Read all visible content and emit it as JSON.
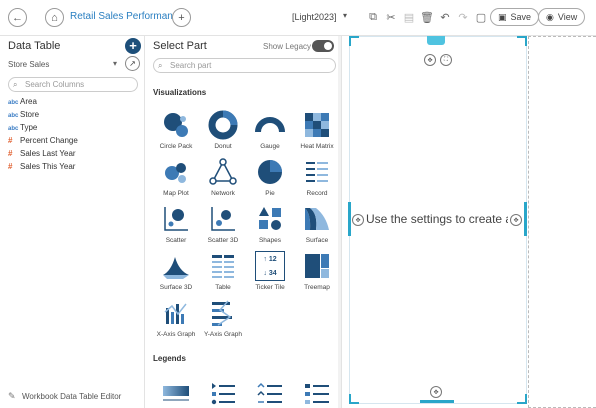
{
  "toolbar": {
    "back_icon": "←",
    "home_icon": "⌂",
    "dashboard_title": "Retail Sales Performance",
    "add_icon": "+",
    "theme": "[Light2023]",
    "theme_caret": "▾",
    "save_label": "Save",
    "view_label": "View",
    "icons": {
      "copy": "⧉",
      "cut": "✂",
      "paste": "▤",
      "delete": "🗑",
      "undo": "↶",
      "redo": "↷",
      "comment": "▢",
      "save": "▣",
      "view": "◉"
    }
  },
  "data_table": {
    "title": "Data Table",
    "add_icon": "+",
    "source": "Store Sales",
    "source_caret": "▾",
    "link_icon": "↗",
    "search_placeholder": "Search Columns",
    "columns": [
      {
        "type_label": "abc",
        "name": "Area"
      },
      {
        "type_label": "abc",
        "name": "Store"
      },
      {
        "type_label": "abc",
        "name": "Type"
      },
      {
        "type_label": "#",
        "name": "Percent Change"
      },
      {
        "type_label": "#",
        "name": "Sales Last Year"
      },
      {
        "type_label": "#",
        "name": "Sales This Year"
      }
    ],
    "editor_label": "Workbook Data Table Editor",
    "editor_icon": "✎"
  },
  "select_part": {
    "title": "Select Part",
    "legacy_label": "Show Legacy",
    "search_placeholder": "Search part",
    "search_icon": "⌕",
    "visualizations_title": "Visualizations",
    "visualizations": [
      "Circle Pack",
      "Donut",
      "Gauge",
      "Heat Matrix",
      "Map Plot",
      "Network",
      "Pie",
      "Record",
      "Scatter",
      "Scatter 3D",
      "Shapes",
      "Surface",
      "Surface 3D",
      "Table",
      "Ticker Tile",
      "Treemap",
      "X-Axis Graph",
      "Y-Axis Graph"
    ],
    "ticker_up": "↑ 12",
    "ticker_down": "↓ 34",
    "legends_title": "Legends"
  },
  "canvas": {
    "message": "Use the settings to create a part",
    "move_icon": "✥",
    "expand_icon": "⛶",
    "add_icon": "+"
  },
  "colors": {
    "accent": "#29a6c9",
    "chart_dark": "#1f4e79",
    "chart_mid": "#3d7ab5",
    "chart_light": "#8fb8de"
  }
}
